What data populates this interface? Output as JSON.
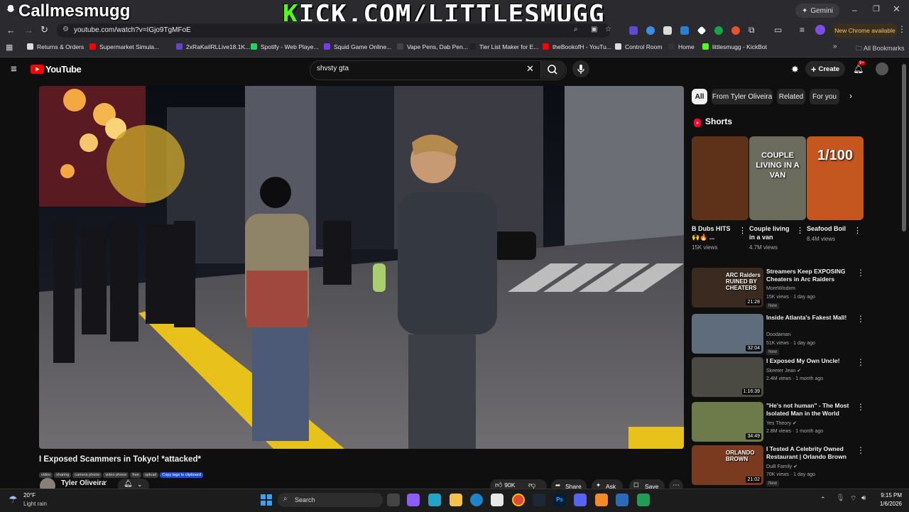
{
  "overlay": {
    "left_text": "Callmesmugg",
    "kick_k": "K",
    "kick_rest": "ICK.COM/LITTLESMUGG"
  },
  "browser": {
    "gemini_label": "Gemini",
    "url": "youtube.com/watch?v=IGjo9TgMFoE",
    "new_chrome": "New Chrome available",
    "bookmarks": [
      "Returns & Orders",
      "Supermarket Simula...",
      "2xRaKaiIRLLive18.1K...",
      "Spotify - Web Playe...",
      "Squid Game Online...",
      "Vape Pens, Dab Pen...",
      "Tier List Maker for E...",
      "theBookofH - YouTu...",
      "Control Room",
      "Home",
      "littlesmugg - KickBot"
    ],
    "all_bookmarks": "All Bookmarks"
  },
  "youtube": {
    "logo": "YouTube",
    "search_value": "shvsty gta",
    "create_label": "Create",
    "notif_badge": "9+",
    "video": {
      "title": "I Exposed Scammers in Tokyo! *attacked*",
      "tags": [
        "video",
        "sharing",
        "camera phone",
        "video phone",
        "free",
        "upload"
      ],
      "copy_tags": "Copy tags to clipboard",
      "channel": "Tyler Oliveira",
      "likes": "90K",
      "share": "Share",
      "ask": "Ask",
      "save": "Save"
    },
    "filter_tabs": [
      "All",
      "From Tyler Oliveira",
      "Related",
      "For you"
    ],
    "shorts_heading": "Shorts",
    "shorts": [
      {
        "title": "B Dubs HITS 🙌🔥 ...",
        "views": "15K views",
        "thumb_text": ""
      },
      {
        "title": "Couple living in a van",
        "views": "4.7M views",
        "thumb_text": "COUPLE LIVING IN A VAN"
      },
      {
        "title": "Seafood Boil",
        "views": "8.4M views",
        "thumb_text": "1/100"
      }
    ],
    "recommended": [
      {
        "title": "Streamers Keep EXPOSING Cheaters in Arc Raiders",
        "channel": "MoreWisdxm",
        "meta": "15K views · 1 day ago",
        "badge": "New",
        "duration": "21:28",
        "thumb_text": "ARC Raiders RUINED BY CHEATERS",
        "color": "#3b2a20"
      },
      {
        "title": "Inside Atlanta's Fakest Mall!",
        "channel": "Doodaman",
        "meta": "51K views · 1 day ago",
        "badge": "New",
        "duration": "32:04",
        "thumb_text": "",
        "color": "#5f6c7b"
      },
      {
        "title": "I Exposed My Own Uncle!",
        "channel": "Skeeter Jean ✔",
        "meta": "2.4M views · 1 month ago",
        "badge": "",
        "duration": "1:16:39",
        "thumb_text": "",
        "color": "#4a4a42"
      },
      {
        "title": "\"He's not human\" - The Most Isolated Man in the World",
        "channel": "Yes Theory ✔",
        "meta": "2.8M views · 1 month ago",
        "badge": "",
        "duration": "34:49",
        "thumb_text": "",
        "color": "#6d7a4a"
      },
      {
        "title": "I Tested A Celebrity Owned Restaurant | Orlando Brown",
        "channel": "DuB Family ✔",
        "meta": "70K views · 1 day ago",
        "badge": "New",
        "duration": "21:02",
        "thumb_text": "ORLANDO BROWN",
        "color": "#7a3a20"
      }
    ]
  },
  "taskbar": {
    "weather_temp": "20°F",
    "weather_desc": "Light rain",
    "search_label": "Search",
    "time": "9:15 PM",
    "date": "1/6/2026"
  }
}
